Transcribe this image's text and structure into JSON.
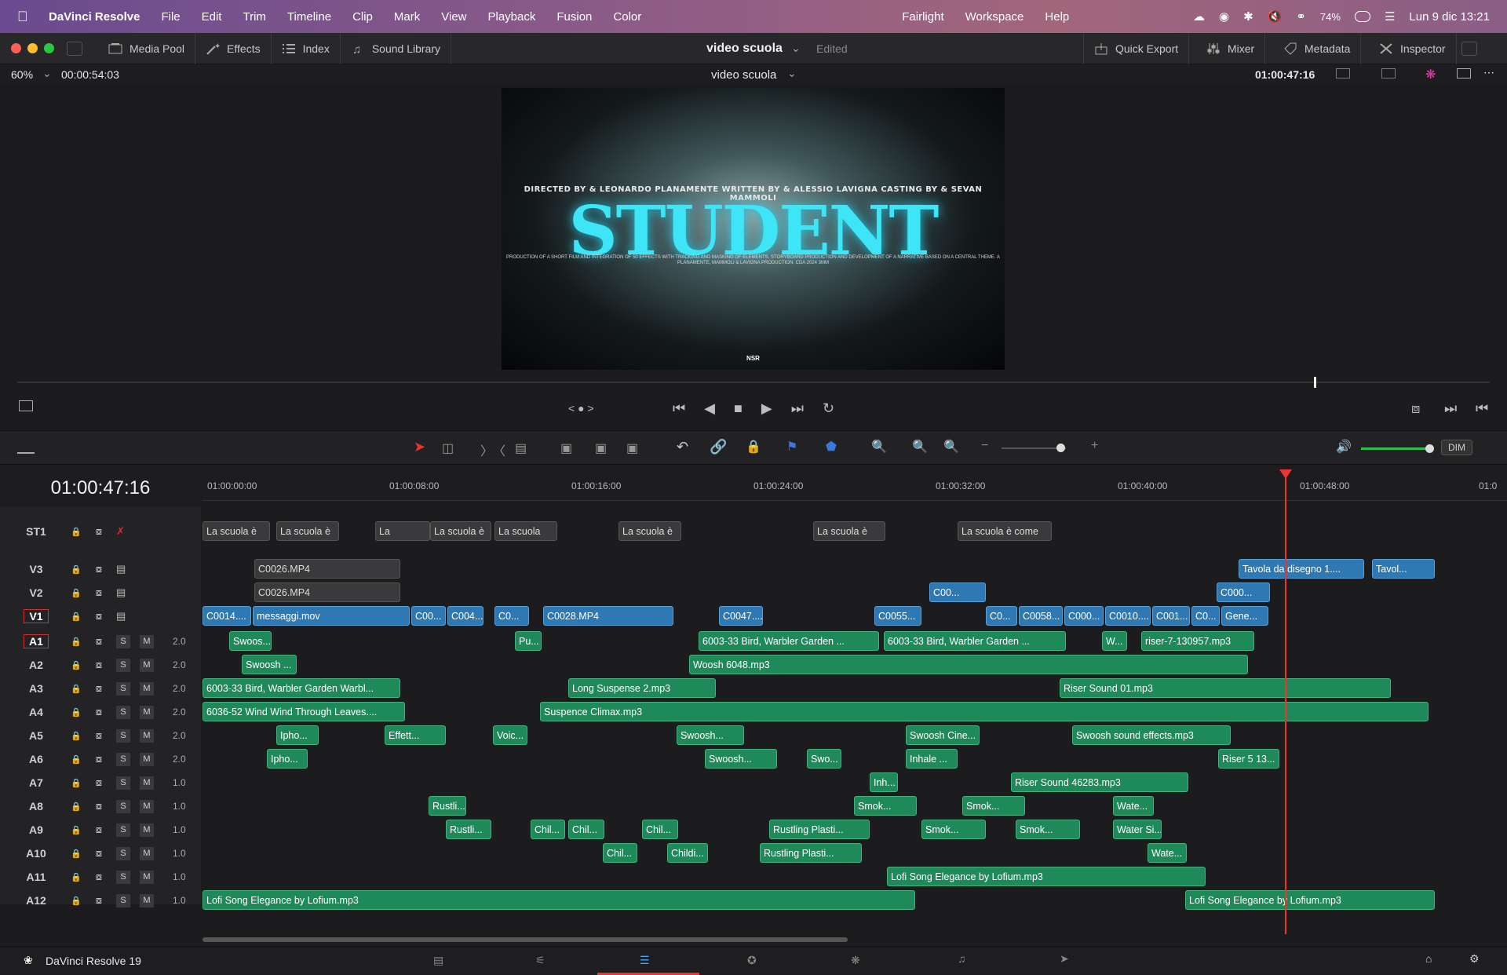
{
  "menubar": {
    "app": "DaVinci Resolve",
    "items": [
      "File",
      "Edit",
      "Trim",
      "Timeline",
      "Clip",
      "Mark",
      "View",
      "Playback",
      "Fusion",
      "Color"
    ],
    "right_items": [
      "Fairlight",
      "Workspace",
      "Help"
    ],
    "battery": "74%",
    "datetime": "Lun 9 dic  13:21"
  },
  "toolbar": {
    "media_pool": "Media Pool",
    "effects": "Effects",
    "index": "Index",
    "sound_library": "Sound Library",
    "project": "video scuola",
    "edited": "Edited",
    "quick_export": "Quick Export",
    "mixer": "Mixer",
    "metadata": "Metadata",
    "inspector": "Inspector"
  },
  "viewer": {
    "zoom": "60%",
    "duration": "00:00:54:03",
    "timeline_name": "video scuola",
    "timecode": "01:00:47:16"
  },
  "frame": {
    "credits": "DIRECTED BY & LEONARDO PLANAMENTE  WRITTEN BY & ALESSIO LAVIGNA  CASTING BY & SEVAN MAMMOLI",
    "title": "STUDENT",
    "sub": "PRODUCTION OF A SHORT FILM AND INTEGRATION OF 50 EFFECTS WITH TRACKING AND MASKING OF ELEMENTS, STORYBOARD PRODUCTION AND DEVELOPMENT OF A NARRATIVE BASED ON A CENTRAL THEME. A PLANAMENTE, MAMMOLI & LAVIGNA PRODUCTION. CDA 2024 3MM",
    "logo": "NSR"
  },
  "timeline": {
    "timecode": "01:00:47:16",
    "ruler": [
      "01:00:00:00",
      "01:00:08:00",
      "01:00:16:00",
      "01:00:24:00",
      "01:00:32:00",
      "01:00:40:00",
      "01:00:48:00",
      "01:0"
    ],
    "dim": "DIM"
  },
  "tracks": [
    {
      "id": "ST1",
      "level": ""
    },
    {
      "id": "V3",
      "level": ""
    },
    {
      "id": "V2",
      "level": ""
    },
    {
      "id": "V1",
      "level": ""
    },
    {
      "id": "A1",
      "level": "2.0"
    },
    {
      "id": "A2",
      "level": "2.0"
    },
    {
      "id": "A3",
      "level": "2.0"
    },
    {
      "id": "A4",
      "level": "2.0"
    },
    {
      "id": "A5",
      "level": "2.0"
    },
    {
      "id": "A6",
      "level": "2.0"
    },
    {
      "id": "A7",
      "level": "1.0"
    },
    {
      "id": "A8",
      "level": "1.0"
    },
    {
      "id": "A9",
      "level": "1.0"
    },
    {
      "id": "A10",
      "level": "1.0"
    },
    {
      "id": "A11",
      "level": "1.0"
    },
    {
      "id": "A12",
      "level": "1.0"
    }
  ],
  "track_buttons": {
    "solo": "S",
    "mute": "M"
  },
  "clips": {
    "ST1": [
      "La scuola è",
      "La scuola è",
      "La",
      "La scuola è",
      "La scuola",
      "La scuola è",
      "La scuola è",
      "La scuola è come"
    ],
    "V3": [
      "C0026.MP4",
      "Tavola da disegno 1....",
      "Tavol..."
    ],
    "V2": [
      "C0026.MP4",
      "C00...",
      "C000..."
    ],
    "V1": [
      "C0014....",
      "messaggi.mov",
      "C00...",
      "C004...",
      "C0...",
      "C0028.MP4",
      "C0047....",
      "C0055...",
      "C0...",
      "C0058...",
      "C000...",
      "C0010....",
      "C001...",
      "C0...",
      "Gene..."
    ],
    "A1": [
      "Swoos...",
      "Pu...",
      "6003-33 Bird, Warbler Garden ...",
      "6003-33 Bird, Warbler Garden ...",
      "W...",
      "riser-7-130957.mp3"
    ],
    "A2": [
      "Swoosh ...",
      "Woosh 6048.mp3"
    ],
    "A3": [
      "6003-33 Bird, Warbler Garden Warbl...",
      "Long Suspense 2.mp3",
      "Riser Sound 01.mp3"
    ],
    "A4": [
      "6036-52 Wind Wind Through Leaves....",
      "Suspence Climax.mp3"
    ],
    "A5": [
      "Ipho...",
      "Effett...",
      "Voic...",
      "Swoosh...",
      "Swoosh Cine...",
      "Swoosh sound effects.mp3"
    ],
    "A6": [
      "Ipho...",
      "Swoosh...",
      "Swo...",
      "Inhale ...",
      "Riser 5 13..."
    ],
    "A7": [
      "Inh...",
      "Riser Sound 46283.mp3"
    ],
    "A8": [
      "Rustli...",
      "Smok...",
      "Smok...",
      "Wate..."
    ],
    "A9": [
      "Rustli...",
      "Chil...",
      "Chil...",
      "Chil...",
      "Rustling Plasti...",
      "Smok...",
      "Smok...",
      "Water Si..."
    ],
    "A10": [
      "Chil...",
      "Childi...",
      "Rustling Plasti...",
      "Wate..."
    ],
    "A11": [
      "Lofi Song Elegance by Lofium.mp3"
    ],
    "A12": [
      "Lofi Song Elegance by Lofium.mp3",
      "Lofi Song Elegance by Lofium.mp3"
    ]
  },
  "footer": {
    "app_version": "DaVinci Resolve 19"
  },
  "colors": {
    "accent_red": "#e33",
    "video_clip": "#2e78b4",
    "audio_clip": "#1e8a5a",
    "title_cyan": "#3ee5f6"
  }
}
